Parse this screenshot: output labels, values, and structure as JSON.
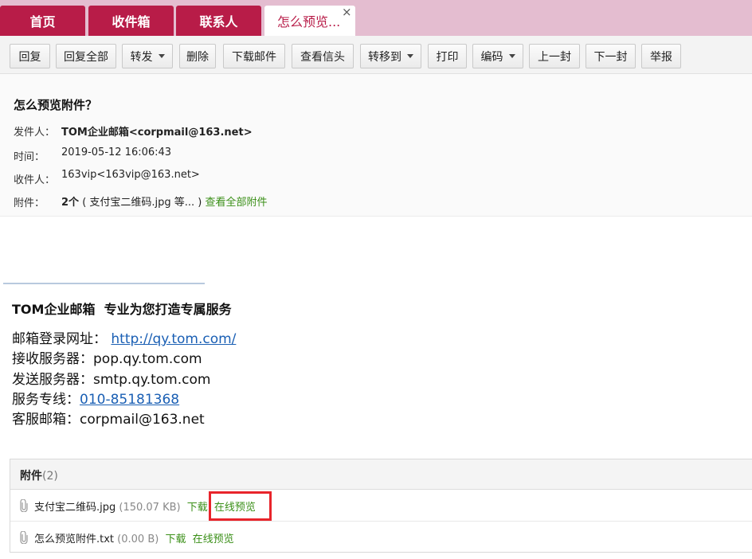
{
  "tabs": [
    {
      "label": "首页"
    },
    {
      "label": "收件箱"
    },
    {
      "label": "联系人"
    },
    {
      "label": "怎么预览..."
    }
  ],
  "tab_close": "×",
  "toolbar": {
    "reply": "回复",
    "reply_all": "回复全部",
    "forward": "转发",
    "delete": "删除",
    "download_mail": "下载邮件",
    "view_header": "查看信头",
    "move_to": "转移到",
    "print": "打印",
    "encoding": "编码",
    "prev": "上一封",
    "next": "下一封",
    "report": "举报"
  },
  "mail": {
    "subject": "怎么预览附件？",
    "from_label": "发件人：",
    "from": "TOM企业邮箱<corpmail@163.net>",
    "time_label": "时间：",
    "time": "2019-05-12 16:06:43",
    "to_label": "收件人：",
    "to": "163vip<163vip@163.net>",
    "attach_label": "附件：",
    "attach_count": "2个",
    "attach_summary": "( 支付宝二维码.jpg 等... )",
    "view_all": "查看全部附件"
  },
  "body": {
    "title": "TOM企业邮箱  专业为您打造专属服务",
    "login_label": "邮箱登录网址：",
    "login_url": "http://qy.tom.com/",
    "pop": "接收服务器：pop.qy.tom.com",
    "smtp": "发送服务器：smtp.qy.tom.com",
    "hotline_label": "服务专线：",
    "hotline": "010-85181368",
    "service_mail": "客服邮箱：corpmail@163.net"
  },
  "attachments": {
    "title": "附件",
    "count": "(2)",
    "items": [
      {
        "name": "支付宝二维码.jpg",
        "size": "(150.07 KB)",
        "download": "下载",
        "preview": "在线预览"
      },
      {
        "name": "怎么预览附件.txt",
        "size": "(0.00 B)",
        "download": "下载",
        "preview": "在线预览"
      }
    ]
  },
  "colors": {
    "tab_bg": "#b81c48",
    "tabbar_bg": "#e4bdd0",
    "link_green": "#3a8f17",
    "link_blue": "#1a5fb4",
    "highlight": "#e8242b"
  }
}
